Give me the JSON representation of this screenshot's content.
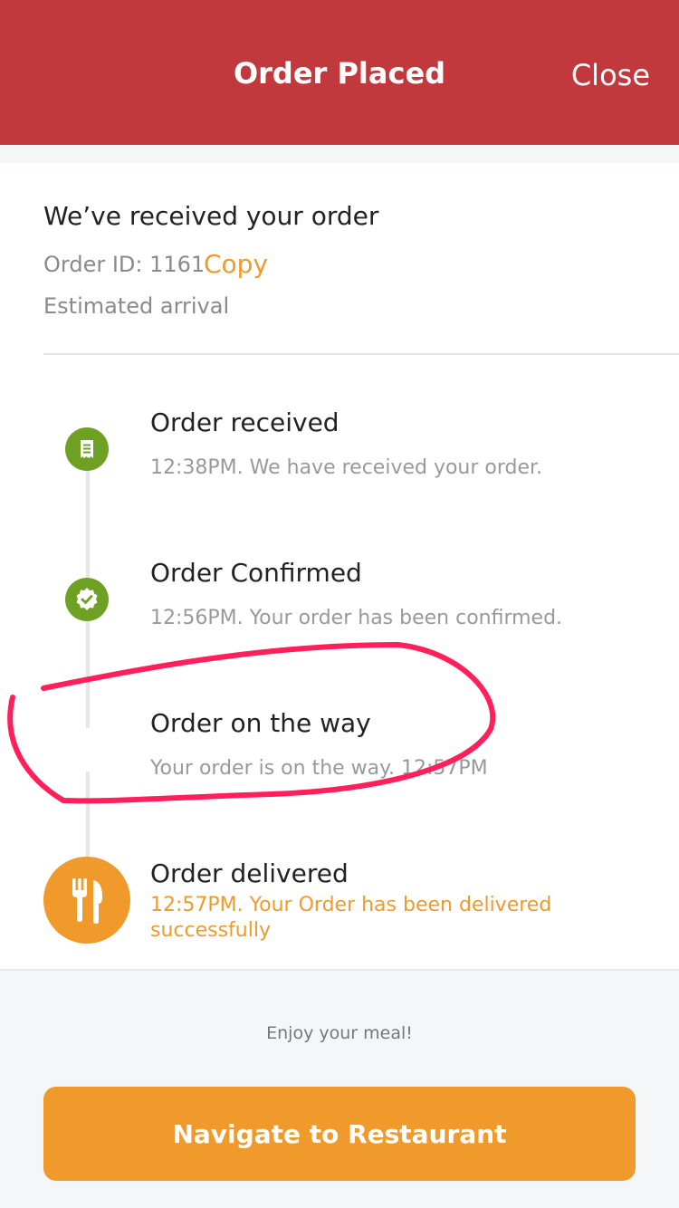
{
  "header": {
    "title": "Order Placed",
    "close_label": "Close",
    "bg_color": "#c1393c"
  },
  "summary": {
    "heading": "We’ve received your order",
    "order_id": "Order ID: 1161",
    "copy_label": "Copy",
    "eta_label": "Estimated arrival"
  },
  "timeline": [
    {
      "title": "Order received",
      "desc": "12:38PM. We have received your order.",
      "icon": "receipt-icon"
    },
    {
      "title": "Order Confirmed",
      "desc": "12:56PM. Your order has been confirmed.",
      "icon": "check-badge-icon"
    },
    {
      "title": "Order on the way",
      "desc": "Your order is on the way. 12:57PM",
      "icon": "none"
    },
    {
      "title": "Order delivered",
      "desc": "12:57PM. Your Order has been delivered successfully",
      "icon": "fork-knife-icon"
    }
  ],
  "footer": {
    "message": "Enjoy your meal!",
    "button_label": "Navigate to Restaurant"
  },
  "colors": {
    "accent": "#f09a2c",
    "success": "#6ea024",
    "annotation": "#ff1f5a"
  }
}
